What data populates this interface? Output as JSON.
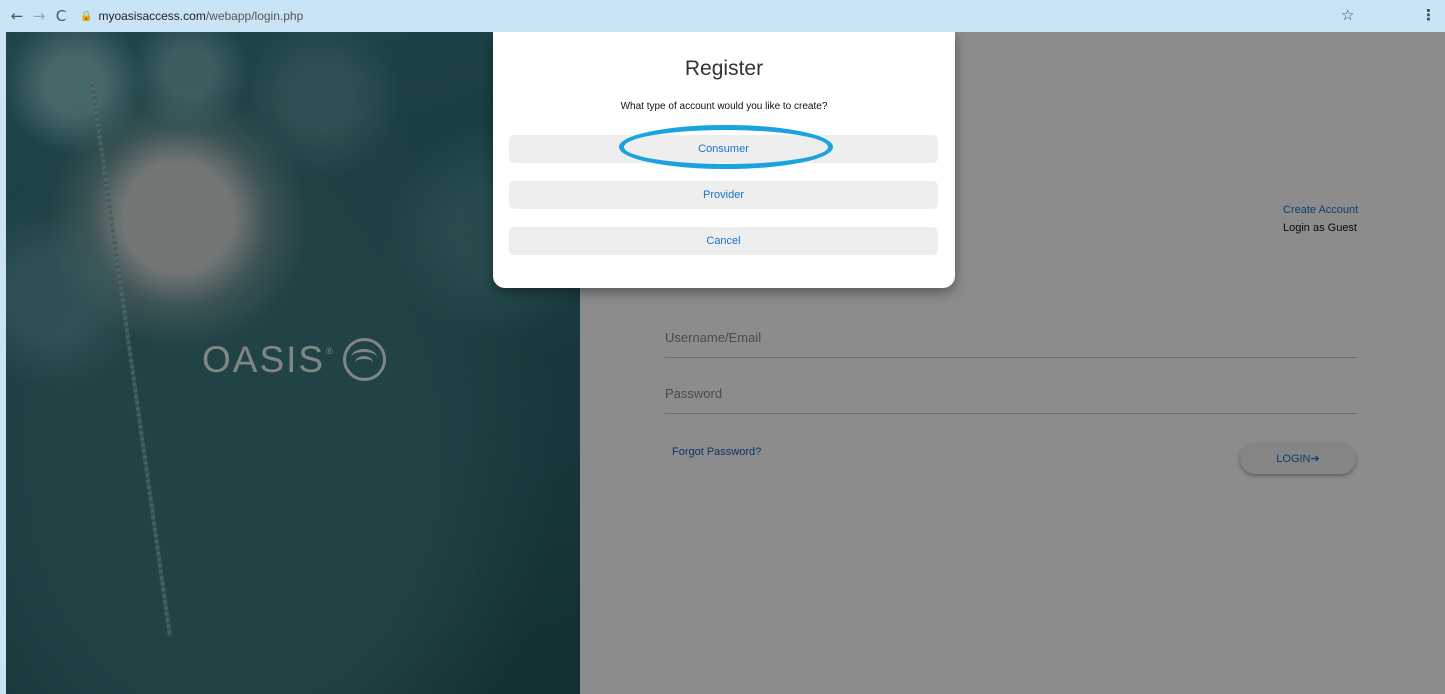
{
  "browser": {
    "back_icon": "←",
    "forward_icon": "→",
    "reload_icon": "C",
    "lock_icon": "🔒",
    "url_host": "myoasisaccess.com",
    "url_path": "/webapp/login.php",
    "star_icon": "☆",
    "menu_icon": "⋮"
  },
  "logo": {
    "text": "OASIS",
    "reg": "®"
  },
  "login": {
    "create_account": "Create Account",
    "login_guest": "Login as Guest",
    "username_placeholder": "Username/Email",
    "password_placeholder": "Password",
    "forgot_password": "Forgot Password?",
    "login_button": "LOGIN➔"
  },
  "modal": {
    "title": "Register",
    "subtitle": "What type of account would you like to create?",
    "options": [
      {
        "label": "Consumer"
      },
      {
        "label": "Provider"
      },
      {
        "label": "Cancel"
      }
    ]
  },
  "colors": {
    "highlight": "#1aa3e0",
    "link": "#1a73c8",
    "browser_bar": "#c9e4f5"
  }
}
